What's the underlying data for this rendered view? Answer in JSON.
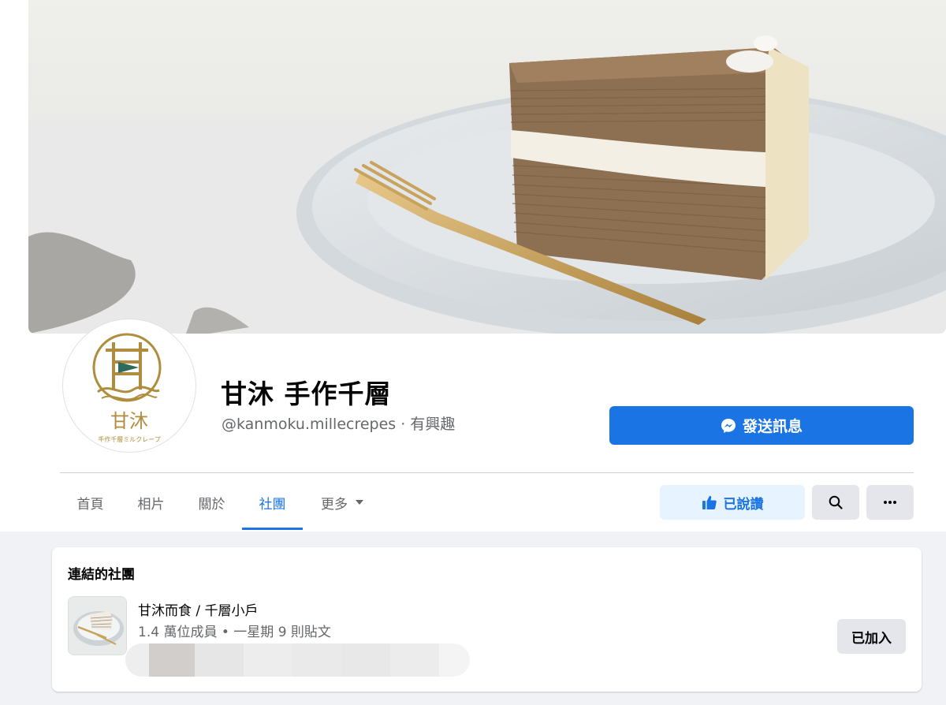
{
  "page": {
    "name": "甘沐 手作千層",
    "handle": "@kanmoku.millecrepes",
    "separator": "·",
    "category": "有興趣"
  },
  "avatar": {
    "logo_char": "甘",
    "logo_text": "甘沐",
    "logo_tagline": "手作千層ミルクレープ",
    "brand_color": "#b08d3e",
    "flag_color": "#2f6b5a"
  },
  "actions": {
    "message_label": "發送訊息",
    "like_label": "已說讚"
  },
  "tabs": [
    {
      "label": "首頁",
      "active": false
    },
    {
      "label": "相片",
      "active": false
    },
    {
      "label": "關於",
      "active": false
    },
    {
      "label": "社團",
      "active": true
    },
    {
      "label": "更多",
      "active": false
    }
  ],
  "linked_groups": {
    "title": "連結的社團",
    "group": {
      "name": "甘沐而食 / 千層小戶",
      "members": "1.4 萬位成員",
      "dot": "•",
      "activity": "一星期 9 則貼文",
      "joined_label": "已加入"
    }
  },
  "colors": {
    "accent": "#1b74e4",
    "accent_light": "#e7f3ff",
    "secondary_bg": "#e4e6eb",
    "page_bg": "#f0f2f5",
    "muted_text": "#65676b"
  }
}
